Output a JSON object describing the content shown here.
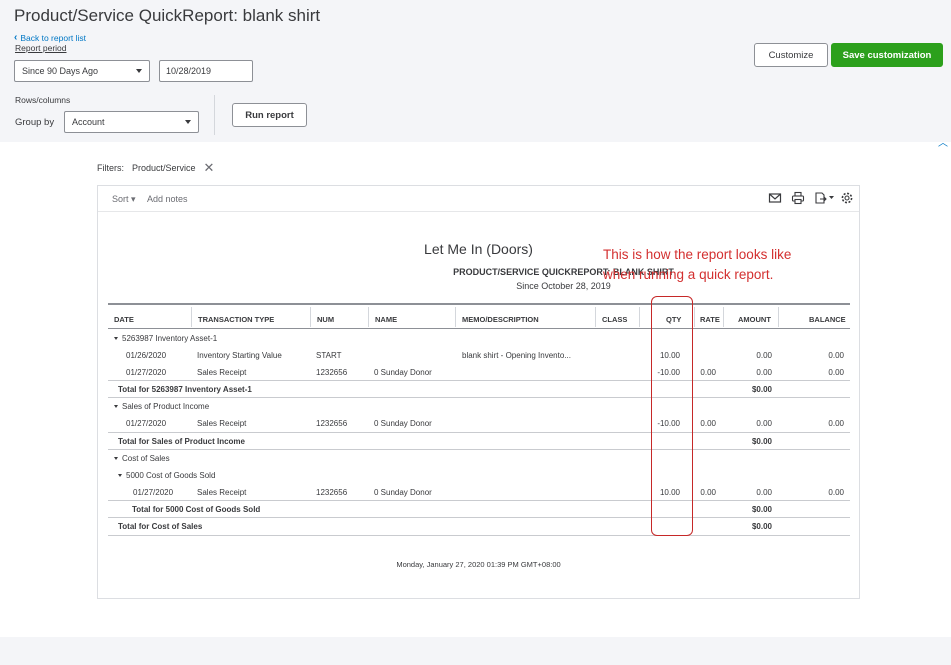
{
  "header": {
    "title": "Product/Service QuickReport: blank shirt",
    "back_link": "Back to report list",
    "report_period_label": "Report period",
    "period_value": "Since 90 Days Ago",
    "date_value": "10/28/2019",
    "rows_columns_label": "Rows/columns",
    "group_by_label": "Group by",
    "group_by_value": "Account",
    "run_report": "Run report",
    "customize": "Customize",
    "save_customization": "Save customization"
  },
  "filters": {
    "label": "Filters:",
    "chip": "Product/Service"
  },
  "toolbar": {
    "sort": "Sort",
    "add_notes": "Add notes"
  },
  "report": {
    "company": "Let Me In (Doors)",
    "title": "PRODUCT/SERVICE QUICKREPORT: BLANK SHIRT",
    "subtitle": "Since October 28, 2019",
    "columns": [
      "DATE",
      "TRANSACTION TYPE",
      "NUM",
      "NAME",
      "MEMO/DESCRIPTION",
      "CLASS",
      "QTY",
      "RATE",
      "AMOUNT",
      "BALANCE"
    ],
    "rows": [
      {
        "group": "5263987 Inventory Asset-1"
      },
      {
        "date": "01/26/2020",
        "type": "Inventory Starting Value",
        "num": "START",
        "name": "",
        "memo": "blank shirt - Opening Invento...",
        "qty": "10.00",
        "rate": "",
        "amount": "0.00",
        "balance": "0.00"
      },
      {
        "date": "01/27/2020",
        "type": "Sales Receipt",
        "num": "1232656",
        "name": "0 Sunday Donor",
        "memo": "",
        "qty": "-10.00",
        "rate": "0.00",
        "amount": "0.00",
        "balance": "0.00"
      },
      {
        "total": "Total for 5263987 Inventory Asset-1",
        "amount": "$0.00"
      },
      {
        "group": "Sales of Product Income"
      },
      {
        "date": "01/27/2020",
        "type": "Sales Receipt",
        "num": "1232656",
        "name": "0 Sunday Donor",
        "memo": "",
        "qty": "-10.00",
        "rate": "0.00",
        "amount": "0.00",
        "balance": "0.00"
      },
      {
        "total": "Total for Sales of Product Income",
        "amount": "$0.00"
      },
      {
        "group": "Cost of Sales"
      },
      {
        "subgroup": "5000 Cost of Goods Sold"
      },
      {
        "date": "01/27/2020",
        "type": "Sales Receipt",
        "num": "1232656",
        "name": "0 Sunday Donor",
        "memo": "",
        "qty": "10.00",
        "rate": "0.00",
        "amount": "0.00",
        "balance": "0.00"
      },
      {
        "total": "Total for 5000 Cost of Goods Sold",
        "amount": "$0.00"
      },
      {
        "total": "Total for Cost of Sales",
        "amount": "$0.00"
      }
    ],
    "footer": "Monday, January 27, 2020   01:39 PM GMT+08:00"
  },
  "annotation": {
    "line1": "This is how the report looks like",
    "line2": "when running a quick report."
  }
}
